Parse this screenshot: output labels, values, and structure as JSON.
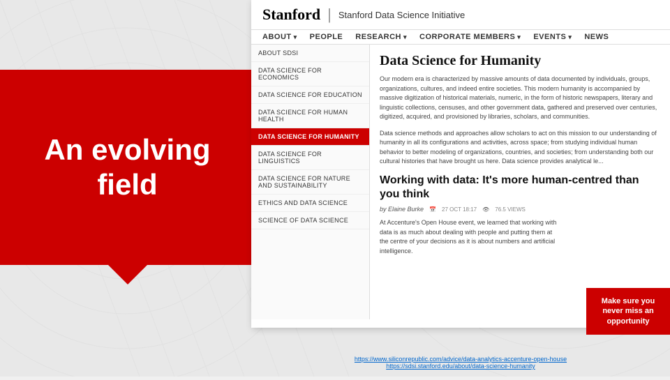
{
  "background": {
    "color": "#e8e8e8"
  },
  "hero": {
    "text_line1": "An evolving",
    "text_line2": "field",
    "bg_color": "#cc0000"
  },
  "header": {
    "logo": "Stanford",
    "separator": "|",
    "initiative": "Stanford Data Science Initiative"
  },
  "nav": {
    "items": [
      {
        "label": "ABOUT",
        "has_arrow": true
      },
      {
        "label": "PEOPLE",
        "has_arrow": false
      },
      {
        "label": "RESEARCH",
        "has_arrow": true
      },
      {
        "label": "CORPORATE MEMBERS",
        "has_arrow": true
      },
      {
        "label": "EVENTS",
        "has_arrow": true
      },
      {
        "label": "NEWS",
        "has_arrow": false
      }
    ]
  },
  "sidebar": {
    "items": [
      {
        "label": "ABOUT SDSI",
        "active": false
      },
      {
        "label": "DATA SCIENCE FOR ECONOMICS",
        "active": false
      },
      {
        "label": "DATA SCIENCE FOR EDUCATION",
        "active": false
      },
      {
        "label": "DATA SCIENCE FOR HUMAN HEALTH",
        "active": false
      },
      {
        "label": "DATA SCIENCE FOR HUMANITY",
        "active": true
      },
      {
        "label": "DATA SCIENCE FOR LINGUISTICS",
        "active": false
      },
      {
        "label": "DATA SCIENCE FOR NATURE AND SUSTAINABILITY",
        "active": false
      },
      {
        "label": "ETHICS AND DATA SCIENCE",
        "active": false
      },
      {
        "label": "SCIENCE OF DATA SCIENCE",
        "active": false
      }
    ]
  },
  "main": {
    "page_title": "Data Science for Humanity",
    "body_text": "Our modern era is characterized by massive amounts of data documented by individuals, groups, organizations, cultures, and indeed entire societies. This modern humanity is accompanied by massive digitization of historical materials, numeric, in the form of historic newspapers, literary and linguistic collections, censuses, and other government data, gathered and preserved over centuries, digitized, acquired, and provisioned by libraries, scholars, and communities.",
    "body_text2": "Data science methods and approaches allow scholars to act on this mission to our understanding of humanity in all its configurations and activities, across space; from studying individual human behavior to better modeling of organizations, countries, and societies; from understanding both our cultural histories that have brought us here. Data science provides analytical le...",
    "article_title": "Working with data: It's more human-centred than you think",
    "byline": "by Elaine Burke",
    "date": "27 OCT 18:17",
    "views": "76.5 VIEWS",
    "article_excerpt": "At Accenture's Open House event, we learned that working with data is as much about dealing with people and putting them at the centre of your decisions as it is about numbers and artificial intelligence."
  },
  "cta": {
    "text": "Make sure you never miss an opportunity"
  },
  "footer_links": [
    {
      "url": "https://www.siliconrepublic.com/advice/data-analytics-accenture-open-house",
      "label": "https://www.siliconrepublic.com/advice/data-analytics-accenture-open-house"
    },
    {
      "url": "https://sdsi.stanford.edu/about/data-science-humanity",
      "label": "https://sdsi.stanford.edu/about/data-science-humanity"
    }
  ]
}
